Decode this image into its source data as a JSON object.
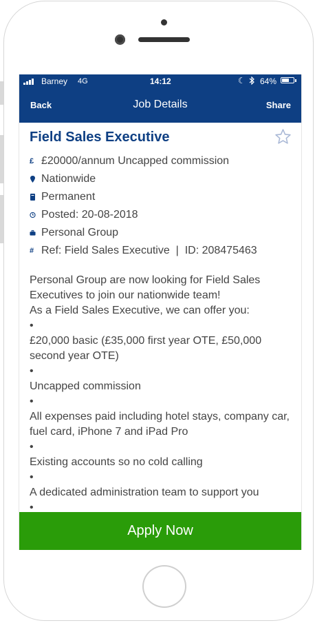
{
  "status_bar": {
    "carrier": "Barney",
    "network": "4G",
    "time": "14:12",
    "battery": "64%",
    "battery_level": 0.64
  },
  "nav": {
    "back_label": "Back",
    "title": "Job Details",
    "share_label": "Share"
  },
  "job": {
    "title": "Field Sales Executive",
    "salary": "£20000/annum Uncapped commission",
    "location": "Nationwide",
    "type": "Permanent",
    "posted": "Posted: 20-08-2018",
    "company": "Personal Group",
    "ref": "Ref: Field Sales Executive  |  ID: 208475463"
  },
  "description": {
    "intro": "Personal Group are now looking for Field Sales Executives to join our nationwide team!",
    "offer_intro": "As a Field Sales Executive, we can offer you:",
    "bullet": "•",
    "items": [
      "£20,000 basic (£35,000 first year OTE, £50,000 second year OTE)",
      "Uncapped commission",
      "All expenses paid including hotel stays, company car, fuel card, iPhone 7 and iPad Pro",
      "Existing accounts so no cold calling",
      "A dedicated administration team to support you"
    ]
  },
  "apply_label": "Apply Now",
  "icons": {
    "salary": "pound-icon",
    "location": "location-pin-icon",
    "type": "document-icon",
    "posted": "clock-icon",
    "company": "briefcase-icon",
    "ref": "hash-icon",
    "favourite": "star-icon"
  },
  "colors": {
    "header": "#0e3f83",
    "accent": "#0e3f83",
    "apply": "#2a9c09",
    "text": "#444444"
  }
}
